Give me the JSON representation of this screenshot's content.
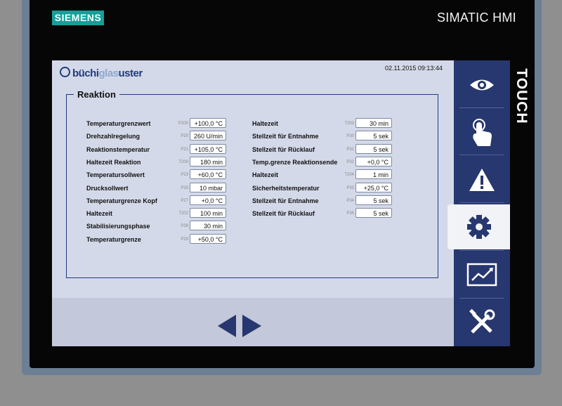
{
  "device": {
    "brand": "SIEMENS",
    "model": "SIMATIC HMI",
    "touch_label": "TOUCH"
  },
  "screen": {
    "brand_part1": "büchi",
    "brand_part2": "glas",
    "brand_part3": "uster",
    "datetime": "02.11.2015 09:13:44",
    "group_title": "Reaktion"
  },
  "left_params": [
    {
      "label": "Temperaturgrenzwert",
      "code": "P200",
      "value": "+100,0 °C"
    },
    {
      "label": "Drehzahlregelung",
      "code": "P20",
      "value": "260 U/min"
    },
    {
      "label": "Reaktionstemperatur",
      "code": "P21",
      "value": "+105,0 °C"
    },
    {
      "label": "Haltezeit Reaktion",
      "code": "T200",
      "value": "180 min"
    },
    {
      "label": "Temperatursollwert",
      "code": "P23",
      "value": "+60,0 °C"
    },
    {
      "label": "Drucksollwert",
      "code": "P25",
      "value": "10 mbar"
    },
    {
      "label": "Temperaturgrenze Kopf",
      "code": "P27",
      "value": "+0,0 °C"
    },
    {
      "label": "Haltezeit",
      "code": "T202",
      "value": "100 min"
    },
    {
      "label": "Stabilisierungsphase",
      "code": "P28",
      "value": "30 min"
    },
    {
      "label": "Temperaturgrenze",
      "code": "P29",
      "value": "+50,0 °C"
    }
  ],
  "right_params": [
    {
      "label": "Haltezeit",
      "code": "T203",
      "value": "30 min"
    },
    {
      "label": "Stellzeit für Entnahme",
      "code": "P30",
      "value": "5 sek"
    },
    {
      "label": "Stellzeit für Rücklauf",
      "code": "P31",
      "value": "5 sek"
    },
    {
      "label": "Temp.grenze Reaktionsende",
      "code": "P32",
      "value": "+0,0 °C"
    },
    {
      "label": "Haltezeit",
      "code": "T204",
      "value": "1 min"
    },
    {
      "label": "Sicherheitstemperatur",
      "code": "P33",
      "value": "+25,0 °C"
    },
    {
      "label": "Stellzeit für Entnahme",
      "code": "P34",
      "value": "5 sek"
    },
    {
      "label": "Stellzeit für Rücklauf",
      "code": "P35",
      "value": "5 sek"
    }
  ],
  "sidebar": [
    {
      "name": "view",
      "icon": "eye-icon"
    },
    {
      "name": "operate",
      "icon": "touch-hand-icon"
    },
    {
      "name": "alarms",
      "icon": "warning-icon"
    },
    {
      "name": "settings",
      "icon": "gear-icon",
      "active": true
    },
    {
      "name": "trends",
      "icon": "chart-icon"
    },
    {
      "name": "service",
      "icon": "tools-icon"
    }
  ],
  "colors": {
    "sidebar": "#27376f",
    "screen_bg": "#d4d9e9",
    "siemens_teal": "#179e9a",
    "accent_blue": "#2b3f86"
  }
}
